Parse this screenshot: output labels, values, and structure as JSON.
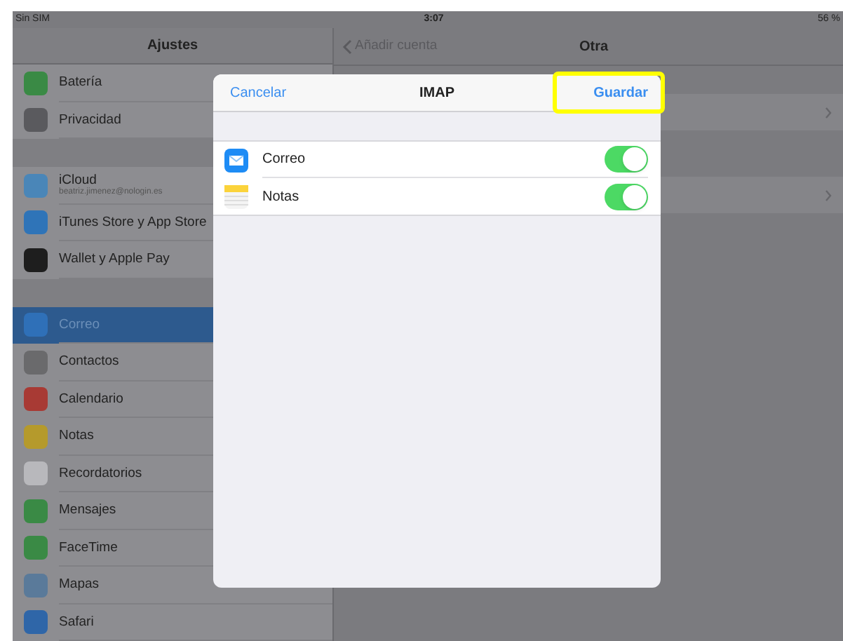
{
  "status_bar": {
    "carrier": "Sin SIM",
    "time": "3:07",
    "battery": "56 %"
  },
  "sidebar": {
    "title": "Ajustes",
    "groups": [
      [
        {
          "label": "Batería",
          "color": "#3a8a45",
          "selected": false
        },
        {
          "label": "Privacidad",
          "color": "#5a5a5e",
          "selected": false
        }
      ],
      [
        {
          "label": "iCloud",
          "subtitle": "beatriz.jimenez@nologin.es",
          "color": "#4a86b8",
          "selected": false
        },
        {
          "label": "iTunes Store y App Store",
          "color": "#2f74b8",
          "selected": false
        },
        {
          "label": "Wallet y Apple Pay",
          "color": "#1e1e1e",
          "selected": false
        }
      ],
      [
        {
          "label": "Correo",
          "color": "#2f70b8",
          "selected": true
        },
        {
          "label": "Contactos",
          "color": "#6a6a6c",
          "selected": false
        },
        {
          "label": "Calendario",
          "color": "#a83a34",
          "selected": false
        },
        {
          "label": "Notas",
          "color": "#b59a2c",
          "selected": false
        },
        {
          "label": "Recordatorios",
          "color": "#b8b8bc",
          "selected": false
        },
        {
          "label": "Mensajes",
          "color": "#3a8a45",
          "selected": false
        },
        {
          "label": "FaceTime",
          "color": "#3a8a45",
          "selected": false
        },
        {
          "label": "Mapas",
          "color": "#5a7a9a",
          "selected": false
        },
        {
          "label": "Safari",
          "color": "#2f66a8",
          "selected": false
        }
      ]
    ]
  },
  "detail": {
    "back": "Añadir cuenta",
    "title": "Otra"
  },
  "modal": {
    "cancel": "Cancelar",
    "title": "IMAP",
    "save": "Guardar",
    "save_highlighted": true,
    "rows": [
      {
        "label": "Correo",
        "on": true
      },
      {
        "label": "Notas",
        "on": true
      }
    ]
  }
}
